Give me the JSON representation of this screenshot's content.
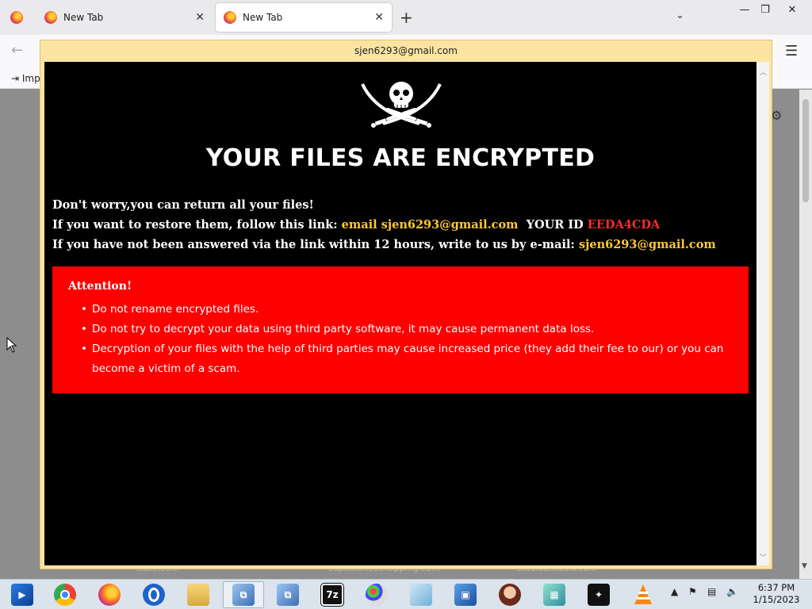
{
  "browser": {
    "tabs": [
      {
        "label": "New Tab",
        "active": false
      },
      {
        "label": "New Tab",
        "active": true
      }
    ],
    "bookmarks_import_label": "Imp",
    "behind_links": [
      "slate.com",
      "capitalonesshopping.com",
      "studiobstudio.com"
    ]
  },
  "window": {
    "title": "sjen6293@gmail.com"
  },
  "note": {
    "headline": "YOUR FILES ARE ENCRYPTED",
    "line1": "Don't worry,you can return all your files!",
    "line2_prefix": "If you want to restore them, follow this link:",
    "line2_email": "email sjen6293@gmail.com",
    "line2_id_label": "YOUR ID",
    "line2_id_value": "EEDA4CDA",
    "line3_prefix": "If you have not been answered via the link within 12 hours, write to us by e-mail:",
    "line3_email": "sjen6293@gmail.com",
    "attention_title": "Attention!",
    "attention_items": [
      "Do not rename encrypted files.",
      "Do not try to decrypt your data using third party software, it may cause permanent data loss.",
      "Decryption of your files with the help of third parties may cause increased price (they add their fee to our) or you can become a victim of a scam."
    ],
    "colors": {
      "background": "#000000",
      "accent_yellow": "#ffc933",
      "id_red": "#ff2b2b",
      "attention_box": "#ff0000"
    }
  },
  "taskbar": {
    "apps": [
      "media-player-icon",
      "chrome-icon",
      "firefox-icon",
      "opera-icon",
      "file-explorer-icon",
      "network-setup-icon",
      "network-setup-icon",
      "7zip-icon",
      "paint-icon",
      "notepad-icon",
      "remote-desktop-icon",
      "portrait-app-icon",
      "cube-app-icon",
      "shuriken-app-icon",
      "vlc-icon"
    ],
    "sevenzip_label": "7z",
    "clock_time": "6:37 PM",
    "clock_date": "1/15/2023"
  }
}
